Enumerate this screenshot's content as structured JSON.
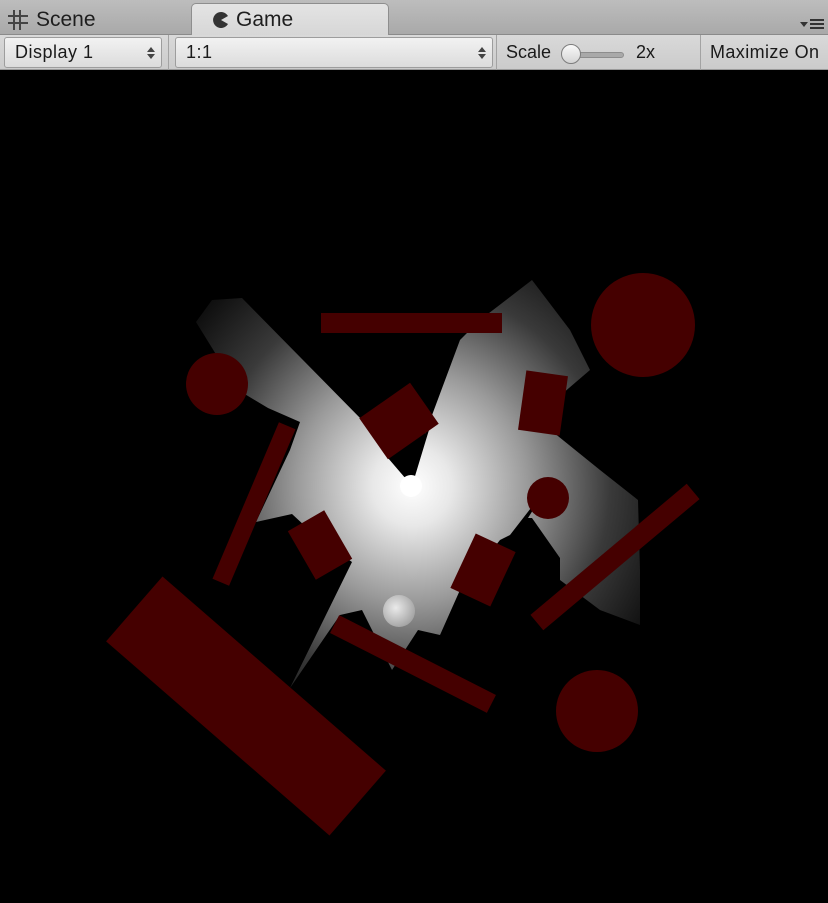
{
  "tabs": [
    {
      "label": "Scene",
      "icon": "grid-icon",
      "active": false
    },
    {
      "label": "Game",
      "icon": "pacman-icon",
      "active": true
    }
  ],
  "toolbar": {
    "display_label": "Display 1",
    "aspect_label": "1:1",
    "scale_label": "Scale",
    "scale_value": "2x",
    "scale_fraction": 0.0,
    "maximize_label": "Maximize On"
  },
  "game_view": {
    "background_color": "#000000",
    "obstacle_color": "#450000",
    "light_color": "#ffffff",
    "objects": [
      "light-source-orb",
      "moving-ball",
      "obstacle-circles",
      "obstacle-bars",
      "obstacle-boxes"
    ]
  }
}
